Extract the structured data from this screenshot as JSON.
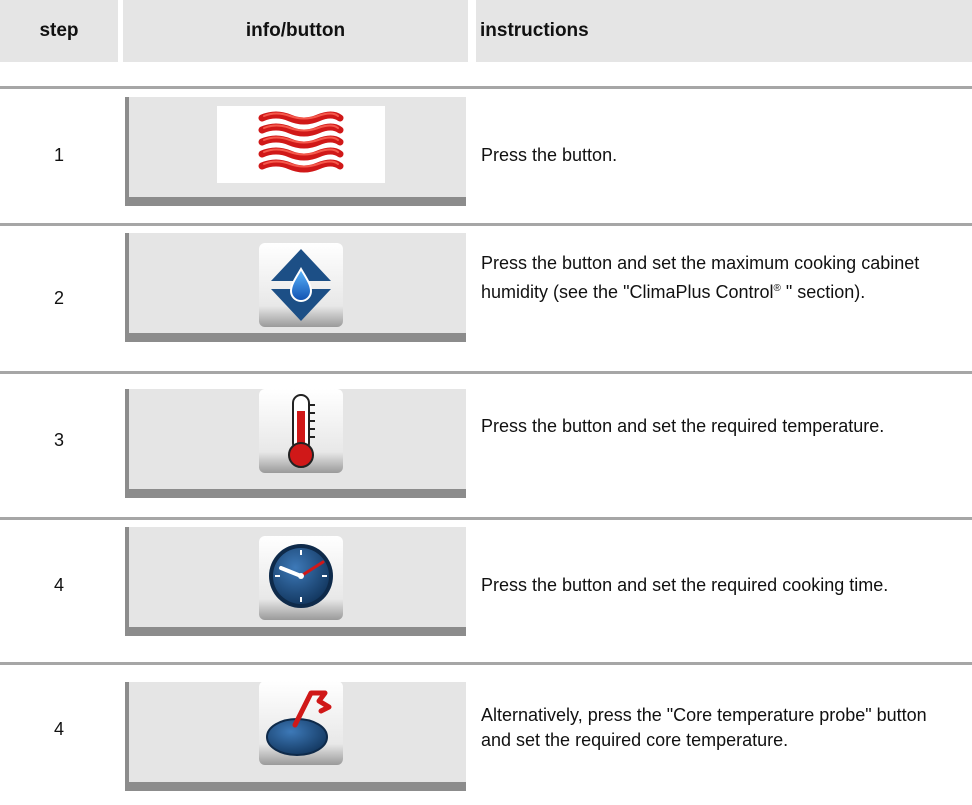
{
  "header": {
    "step": "step",
    "info": "info/button",
    "instructions": "instructions"
  },
  "rows": [
    {
      "step": "1",
      "icon": "heat-waves-icon",
      "instruction": "Press the button."
    },
    {
      "step": "2",
      "icon": "humidity-updown-icon",
      "instruction_pre": "Press the button and set the maximum cooking cabinet humidity (see the \"ClimaPlus Control",
      "instruction_sup": "®",
      "instruction_post": " \" section)."
    },
    {
      "step": "3",
      "icon": "thermometer-icon",
      "instruction": "Press the button and set the required temperature."
    },
    {
      "step": "4",
      "icon": "clock-icon",
      "instruction": "Press the button and set the required cooking time."
    },
    {
      "step": "4",
      "icon": "core-probe-icon",
      "instruction": "Alternatively, press the \"Core temperature probe\" button and set the required core temperature."
    }
  ],
  "colors": {
    "header_bg": "#e5e5e5",
    "rule": "#a6a6a6",
    "panel_border": "#8c8c8c",
    "accent_red": "#d01818",
    "accent_blue": "#1c4f86"
  }
}
